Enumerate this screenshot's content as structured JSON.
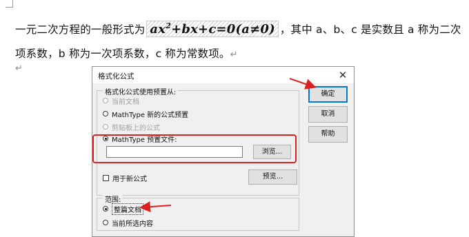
{
  "document": {
    "line1_before": "一元二次方程的一般形式为",
    "formula": {
      "a": "ax",
      "exp": "2",
      "rest": "+bx+c=0(a≠0)"
    },
    "line1_after": "，其中 a、b、c 是实数且 a 称为二次",
    "line2": "项系数，b 称为一次项系数，c 称为常数项。",
    "paragraph_mark": "↵"
  },
  "dialog": {
    "title": "格式化公式",
    "close_glyph": "✕",
    "group1": {
      "legend": "格式化公式使用预置从:",
      "options": [
        {
          "label": "当前文档",
          "enabled": false,
          "selected": false
        },
        {
          "label": "MathType 新的公式预置",
          "enabled": true,
          "selected": false
        },
        {
          "label": "剪贴板上的公式",
          "enabled": false,
          "selected": false
        },
        {
          "label": "MathType 预置文件:",
          "enabled": true,
          "selected": true
        }
      ],
      "file_value": "",
      "browse_label": "浏览...",
      "checkbox_label": "用于新公式",
      "checkbox_checked": false,
      "preview_label": "预览..."
    },
    "group2": {
      "legend": "范围:",
      "options": [
        {
          "label": "整篇文档",
          "selected": true
        },
        {
          "label": "当前所选内容",
          "selected": false
        }
      ]
    },
    "buttons": {
      "ok": "确定",
      "cancel": "取消",
      "help": "帮助"
    }
  },
  "annotation_colors": {
    "highlight": "#e02020"
  }
}
